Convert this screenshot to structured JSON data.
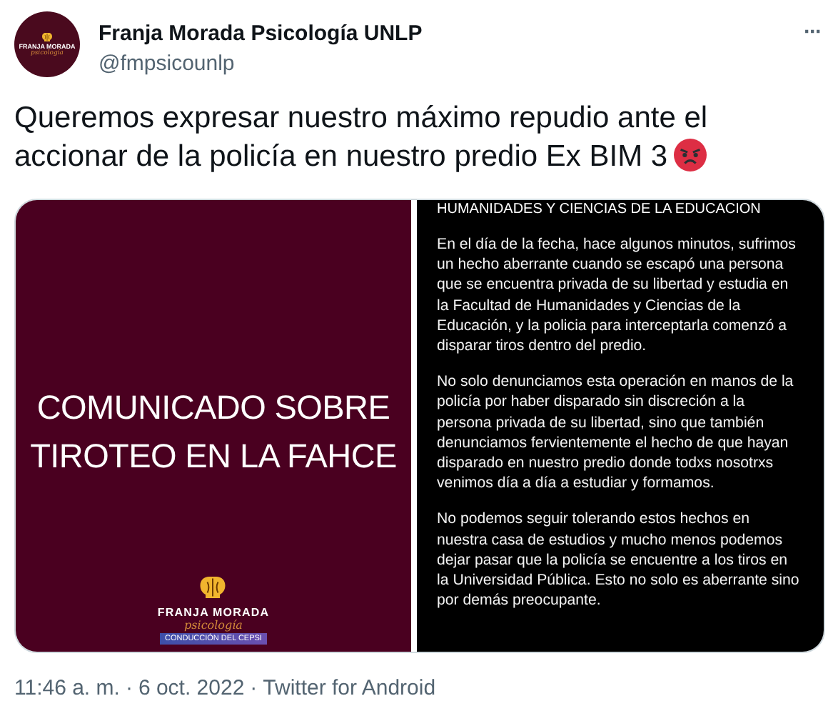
{
  "author": {
    "avatar_title": "FRANJA MORADA",
    "avatar_subtitle": "psicología",
    "name": "Franja Morada Psicología UNLP",
    "handle": "@fmpsicounlp",
    "more": "···"
  },
  "tweet": {
    "text": "Queremos expresar nuestro máximo repudio ante el accionar de la policía en nuestro predio Ex BIM 3"
  },
  "media": [
    {
      "kind": "cover",
      "title_lines": [
        "COMUNICADO SOBRE",
        "TIROTEO EN LA FAHCE"
      ],
      "logo_title": "FRANJA MORADA",
      "logo_script": "psicología",
      "logo_band": "CONDUCCIÓN DEL CEPSI"
    },
    {
      "kind": "statement",
      "heading": "HUMANIDADES Y CIENCIAS DE LA EDUCACION",
      "paragraphs": [
        "En el día de la fecha, hace algunos minutos, sufrimos un hecho aberrante cuando se escapó una persona que se encuentra privada de su libertad y estudia en la Facultad de Humanidades y Ciencias de la Educación, y la policia para interceptarla comenzó a disparar tiros dentro del predio.",
        "No solo denunciamos esta operación en manos de la policía por haber disparado sin discreción a la persona privada de su libertad, sino que también denunciamos fervientemente el hecho de que hayan disparado en nuestro predio donde todxs nosotrxs venimos día a día a estudiar y formamos.",
        "No podemos seguir tolerando estos hechos en nuestra casa de estudios y mucho menos podemos dejar pasar que la policía se encuentre a los tiros en la Universidad Pública. Esto no solo es aberrante sino por demás preocupante."
      ]
    }
  ],
  "footer": {
    "time": "11:46 a. m.",
    "separator": "·",
    "date": "6 oct. 2022",
    "source": "Twitter for Android"
  }
}
